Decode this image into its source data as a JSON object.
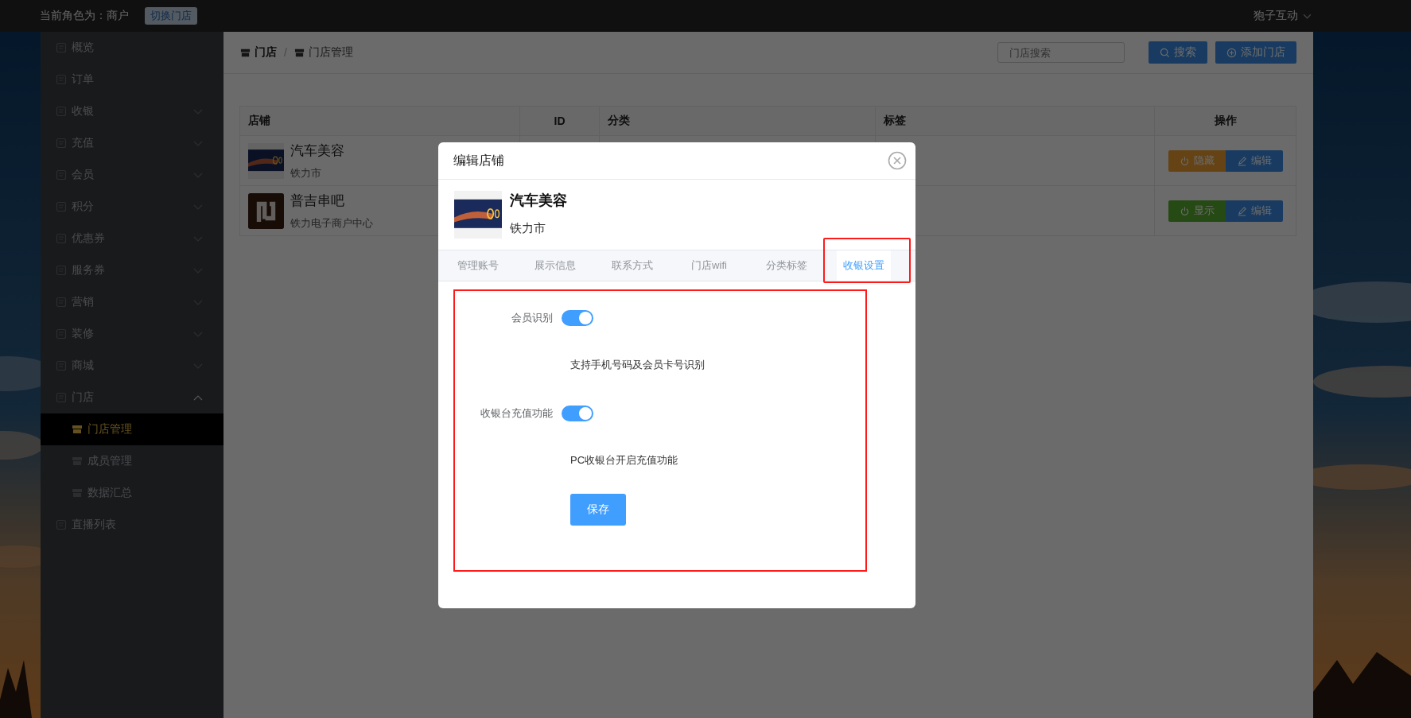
{
  "topbar": {
    "role_text": "当前角色为：商户",
    "switch_button": "切换门店",
    "user": "狍子互动"
  },
  "sidebar": {
    "items": [
      {
        "label": "概览",
        "selected": false
      },
      {
        "label": "订单",
        "selected": false
      },
      {
        "label": "收银",
        "selected": false,
        "expanded": false
      },
      {
        "label": "充值",
        "selected": false,
        "expanded": false
      },
      {
        "label": "会员",
        "selected": false,
        "expanded": false
      },
      {
        "label": "积分",
        "selected": false,
        "expanded": false
      },
      {
        "label": "优惠券",
        "selected": false,
        "expanded": false
      },
      {
        "label": "服务券",
        "selected": false,
        "expanded": false
      },
      {
        "label": "营销",
        "selected": false,
        "expanded": false
      },
      {
        "label": "装修",
        "selected": false,
        "expanded": false
      },
      {
        "label": "商城",
        "selected": false,
        "expanded": false
      },
      {
        "label": "门店",
        "selected": false,
        "expanded": true,
        "children": [
          {
            "label": "门店管理",
            "selected": true
          },
          {
            "label": "成员管理",
            "selected": false
          },
          {
            "label": "数据汇总",
            "selected": false
          }
        ]
      },
      {
        "label": "直播列表",
        "selected": false
      }
    ]
  },
  "breadcrumb": {
    "separator": "/",
    "items": [
      "门店",
      "门店管理"
    ]
  },
  "search": {
    "placeholder": "门店搜索"
  },
  "search_button": "搜索",
  "add_button": "添加门店",
  "table": {
    "columns": [
      "店铺",
      "ID",
      "分类",
      "标签",
      "操作"
    ],
    "rows": [
      {
        "kind": "picture",
        "name": "汽车美容",
        "city": "铁力市",
        "actions": [
          {
            "kind": "hide",
            "label": "隐藏"
          },
          {
            "kind": "edit",
            "label": "编辑"
          }
        ]
      },
      {
        "kind": "logo",
        "name": "普吉串吧",
        "city": "铁力电子商户中心",
        "actions": [
          {
            "kind": "show",
            "label": "显示"
          },
          {
            "kind": "edit",
            "label": "编辑"
          }
        ]
      }
    ]
  },
  "modal": {
    "title": "编辑店铺",
    "store": {
      "name": "汽车美容",
      "city": "铁力市"
    },
    "tabs": [
      {
        "label": "管理账号",
        "selected": false,
        "highlighted": false
      },
      {
        "label": "展示信息",
        "selected": false,
        "highlighted": false
      },
      {
        "label": "联系方式",
        "selected": false,
        "highlighted": false
      },
      {
        "label": "门店wifi",
        "selected": false,
        "highlighted": false
      },
      {
        "label": "分类标签",
        "selected": false,
        "highlighted": false
      },
      {
        "label": "收银设置",
        "selected": true,
        "highlighted": true
      }
    ],
    "settings": {
      "highlighted": true,
      "rows": [
        {
          "label": "会员识别",
          "on": true,
          "help": "支持手机号码及会员卡号识别"
        },
        {
          "label": "收银台充值功能",
          "on": true,
          "help": "PC收银台开启充值功能"
        }
      ],
      "save_button": "保存"
    }
  }
}
